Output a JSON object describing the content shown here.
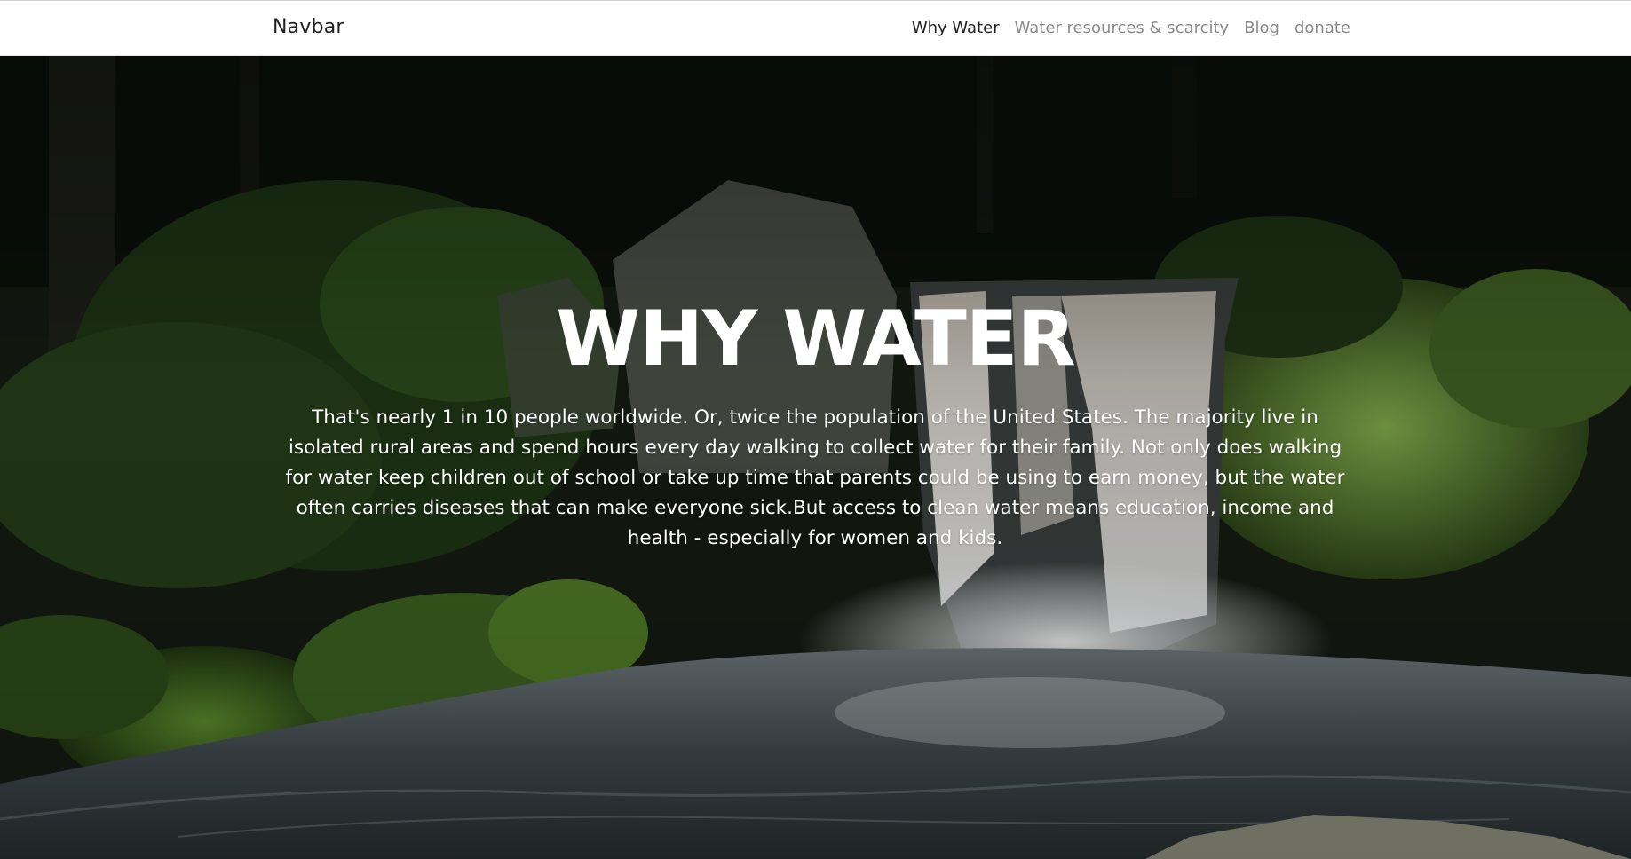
{
  "navbar": {
    "brand": "Navbar",
    "links": [
      {
        "label": "Why Water",
        "active": true
      },
      {
        "label": "Water resources & scarcity",
        "active": false
      },
      {
        "label": "Blog",
        "active": false
      },
      {
        "label": "donate",
        "active": false
      }
    ]
  },
  "hero": {
    "title": "WHY WATER",
    "body": "That's nearly 1 in 10 people worldwide. Or, twice the population of the United States. The majority live in isolated rural areas and spend hours every day walking to collect water for their family. Not only does walking for water keep children out of school or take up time that parents could be using to earn money, but the water often carries diseases that can make everyone sick.But access to clean water means education, income and health - especially for women and kids.",
    "background": "waterfall-forest-photo"
  },
  "colors": {
    "navbar_bg": "#ffffff",
    "nav_active": "#1f1f1f",
    "nav_inactive": "#8a8a8a",
    "hero_text": "#ffffff"
  }
}
